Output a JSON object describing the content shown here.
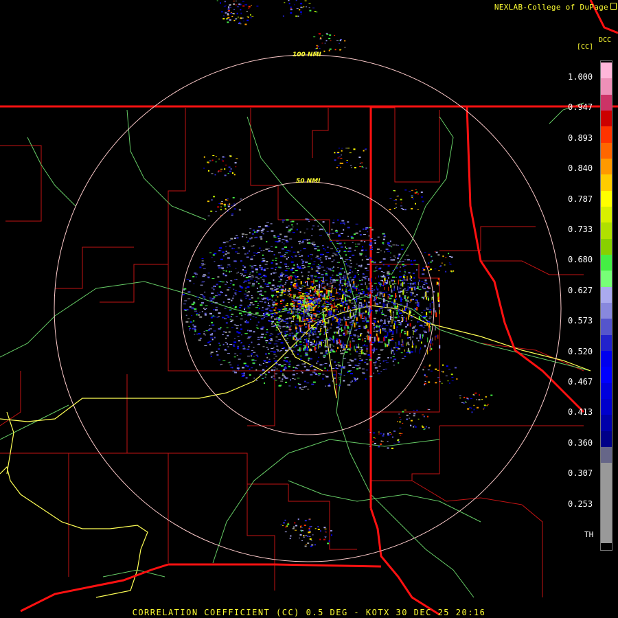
{
  "header": {
    "credit": "NEXLAB-College of DuPage",
    "corner_code": "DCC",
    "unit": "[CC]"
  },
  "range_rings": {
    "inner_label": "50 NMI",
    "outer_label": "100 NMI"
  },
  "colorbar": {
    "tick_labels": [
      "1.000",
      "0.947",
      "0.893",
      "0.840",
      "0.787",
      "0.733",
      "0.680",
      "0.627",
      "0.573",
      "0.520",
      "0.467",
      "0.413",
      "0.360",
      "0.307",
      "0.253"
    ],
    "threshold_label": "TH",
    "colors_top_to_bottom": [
      "#ffb6d9",
      "#ee90b8",
      "#cc3366",
      "#cc0000",
      "#ff3300",
      "#ff6600",
      "#ff9900",
      "#ffcc00",
      "#ffff00",
      "#d8f000",
      "#b0e000",
      "#88d000",
      "#44ee44",
      "#77ff77",
      "#aaaaee",
      "#8888dd",
      "#5555cc",
      "#2222cc",
      "#0000ee",
      "#0000ff",
      "#0000dd",
      "#0000cc",
      "#0000aa",
      "#000088",
      "#666688",
      "#999999",
      "#999999",
      "#999999",
      "#999999",
      "#999999"
    ]
  },
  "colors": {
    "state_border": "#ff1111",
    "county": "#c41414",
    "highway": "#ffff55",
    "river": "#66cc66",
    "ring": "#ffcccc",
    "text": "#ffff33"
  },
  "footer": {
    "text": "CORRELATION COEFFICIENT (CC) 0.5 DEG - KOTX 30 DEC 25 20:16"
  }
}
